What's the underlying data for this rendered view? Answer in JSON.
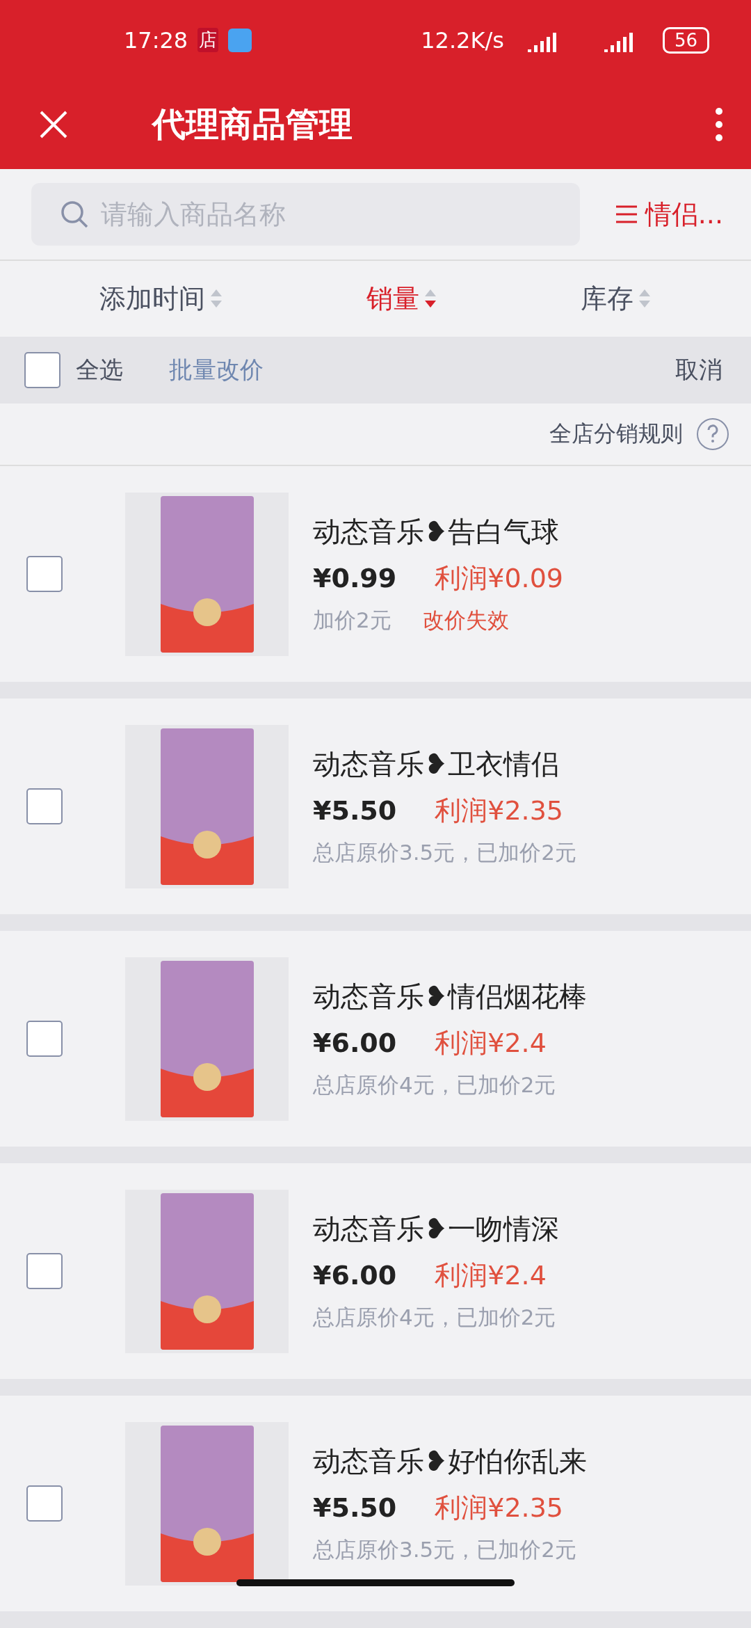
{
  "status_bar": {
    "time": "17:28",
    "shop_badge": "店",
    "speed": "12.2K/s",
    "battery": "56"
  },
  "header": {
    "title": "代理商品管理"
  },
  "search": {
    "placeholder": "请输入商品名称",
    "category": "情侣..."
  },
  "sort_tabs": [
    {
      "label": "添加时间",
      "selected": false
    },
    {
      "label": "销量",
      "selected": true
    },
    {
      "label": "库存",
      "selected": false
    }
  ],
  "batch_bar": {
    "select_all": {
      "label": "全选",
      "checked": false
    },
    "batch_price": "批量改价",
    "cancel": "取消"
  },
  "rules": {
    "label": "全店分销规则"
  },
  "products": [
    {
      "title": "动态音乐❥告白气球",
      "price": "¥0.99",
      "profit": "利润¥0.09",
      "checked": false,
      "notes": [
        {
          "kind": "normal",
          "text": "加价2元"
        },
        {
          "kind": "warning",
          "text": "改价失效"
        }
      ]
    },
    {
      "title": "动态音乐❥卫衣情侣",
      "price": "¥5.50",
      "profit": "利润¥2.35",
      "checked": false,
      "notes": [
        {
          "kind": "normal",
          "text": "总店原价3.5元，已加价2元"
        }
      ]
    },
    {
      "title": "动态音乐❥情侣烟花棒",
      "price": "¥6.00",
      "profit": "利润¥2.4",
      "checked": false,
      "notes": [
        {
          "kind": "normal",
          "text": "总店原价4元，已加价2元"
        }
      ]
    },
    {
      "title": "动态音乐❥一吻情深",
      "price": "¥6.00",
      "profit": "利润¥2.4",
      "checked": false,
      "notes": [
        {
          "kind": "normal",
          "text": "总店原价4元，已加价2元"
        }
      ]
    },
    {
      "title": "动态音乐❥好怕你乱来",
      "price": "¥5.50",
      "profit": "利润¥2.35",
      "checked": false,
      "notes": [
        {
          "kind": "normal",
          "text": "总店原价3.5元，已加价2元"
        }
      ]
    }
  ]
}
